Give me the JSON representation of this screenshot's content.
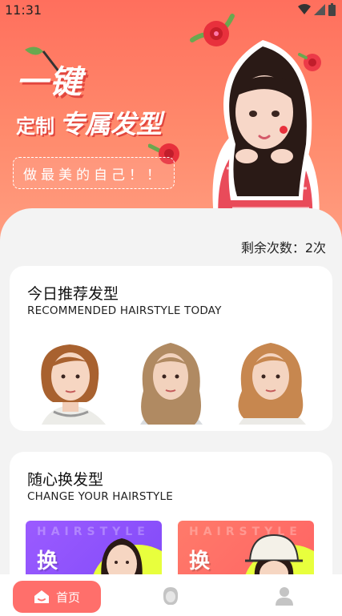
{
  "statusbar": {
    "time": "11:31"
  },
  "hero": {
    "title_line1": "一键",
    "title_line2a": "定制",
    "title_line2b": "专属发型",
    "slogan": "做最美的自己！！"
  },
  "main": {
    "remaining": "剩余次数：2次",
    "recommended": {
      "title": "今日推荐发型",
      "subtitle": "RECOMMENDED HAIRSTYLE TODAY"
    },
    "change": {
      "title": "随心换发型",
      "subtitle": "CHANGE YOUR HAIRSTYLE",
      "tiles": [
        {
          "watermark": "HAIRSTYLE",
          "label": "换"
        },
        {
          "watermark": "HAIRSTYLE",
          "label": "换"
        }
      ]
    }
  },
  "bottomnav": {
    "home_label": "首页"
  },
  "colors": {
    "accent": "#ff6f6b",
    "hero": "#ff7d63"
  }
}
